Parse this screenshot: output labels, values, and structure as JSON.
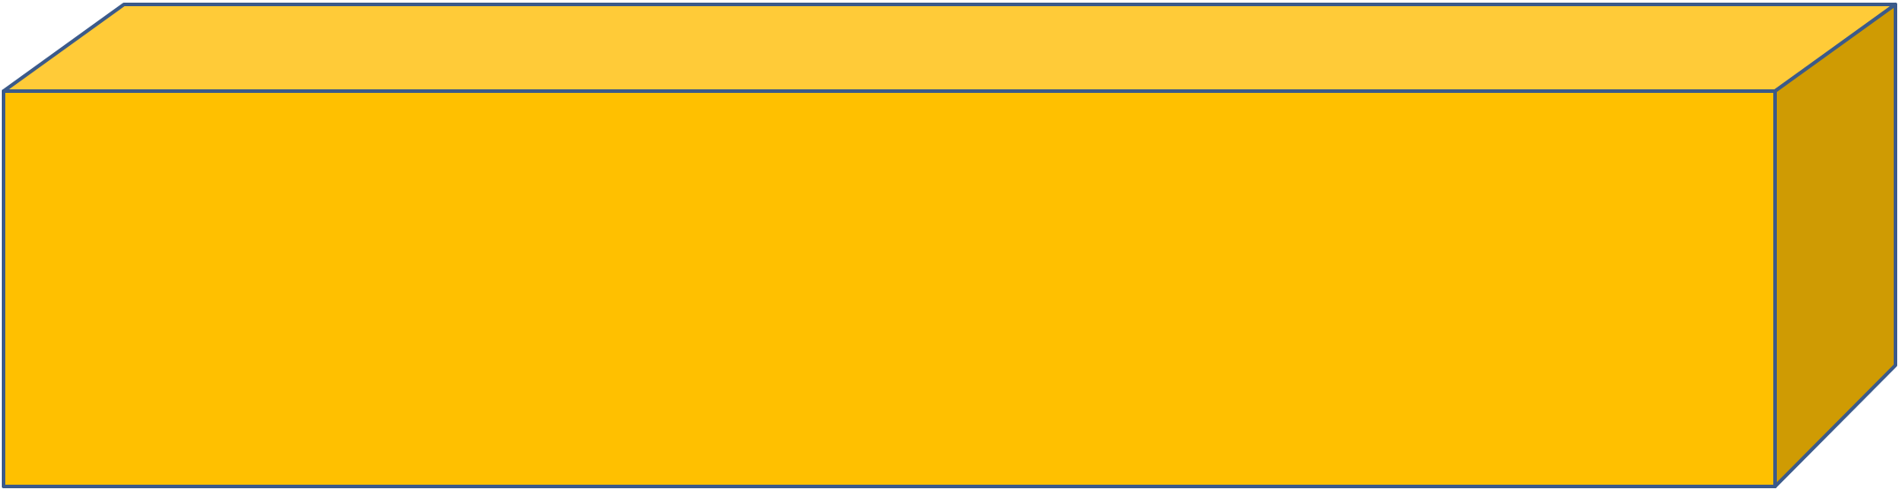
{
  "diagram": {
    "shape": "rectangular-prism",
    "view": "oblique",
    "faces": {
      "front": {
        "color": "#FFC000"
      },
      "top": {
        "color": "#FFCB38"
      },
      "right": {
        "color": "#CF9B03"
      }
    },
    "outline_color": "#3B5A8A"
  }
}
